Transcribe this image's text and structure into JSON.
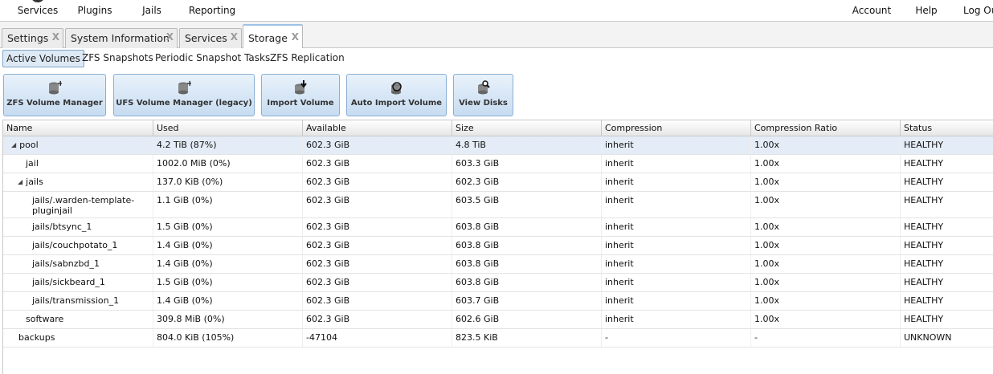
{
  "nav": {
    "items": [
      {
        "label": "Services",
        "icon": "gear-icon"
      },
      {
        "label": "Plugins",
        "icon": "plugin-icon"
      },
      {
        "label": "Jails",
        "icon": "jail-icon"
      },
      {
        "label": "Reporting",
        "icon": "chart-icon"
      },
      {
        "label": "Account",
        "icon": "user-icon"
      },
      {
        "label": "Help",
        "icon": "help-icon"
      },
      {
        "label": "Log Ou",
        "icon": "logout-icon"
      }
    ]
  },
  "tabs": [
    {
      "label": "Settings",
      "close": "X"
    },
    {
      "label": "System Information",
      "close": "X"
    },
    {
      "label": "Services",
      "close": "X"
    },
    {
      "label": "Storage",
      "close": "X"
    }
  ],
  "subtabs": [
    "Active Volumes",
    "ZFS Snapshots",
    "Periodic Snapshot Tasks",
    "ZFS Replication"
  ],
  "toolbar": [
    {
      "label": "ZFS Volume Manager",
      "icon": "database-add-icon"
    },
    {
      "label": "UFS Volume Manager (legacy)",
      "icon": "database-add-icon"
    },
    {
      "label": "Import Volume",
      "icon": "database-import-icon"
    },
    {
      "label": "Auto Import Volume",
      "icon": "database-refresh-icon"
    },
    {
      "label": "View Disks",
      "icon": "database-search-icon"
    }
  ],
  "grid": {
    "columns": [
      "Name",
      "Used",
      "Available",
      "Size",
      "Compression",
      "Compression Ratio",
      "Status"
    ],
    "rows": [
      {
        "name": "pool",
        "expander": "◢",
        "used": "4.2 TiB (87%)",
        "available": "602.3 GiB",
        "size": "4.8 TiB",
        "compression": "inherit",
        "ratio": "1.00x",
        "status": "HEALTHY"
      },
      {
        "name": "jail",
        "expander": "",
        "used": "1002.0 MiB (0%)",
        "available": "602.3 GiB",
        "size": "603.3 GiB",
        "compression": "inherit",
        "ratio": "1.00x",
        "status": "HEALTHY"
      },
      {
        "name": "jails",
        "expander": "◢",
        "used": "137.0 KiB (0%)",
        "available": "602.3 GiB",
        "size": "602.3 GiB",
        "compression": "inherit",
        "ratio": "1.00x",
        "status": "HEALTHY"
      },
      {
        "name": "jails/.warden-template-pluginjail",
        "expander": "",
        "used": "1.1 GiB (0%)",
        "available": "602.3 GiB",
        "size": "603.5 GiB",
        "compression": "inherit",
        "ratio": "1.00x",
        "status": "HEALTHY"
      },
      {
        "name": "jails/btsync_1",
        "expander": "",
        "used": "1.5 GiB (0%)",
        "available": "602.3 GiB",
        "size": "603.8 GiB",
        "compression": "inherit",
        "ratio": "1.00x",
        "status": "HEALTHY"
      },
      {
        "name": "jails/couchpotato_1",
        "expander": "",
        "used": "1.4 GiB (0%)",
        "available": "602.3 GiB",
        "size": "603.8 GiB",
        "compression": "inherit",
        "ratio": "1.00x",
        "status": "HEALTHY"
      },
      {
        "name": "jails/sabnzbd_1",
        "expander": "",
        "used": "1.4 GiB (0%)",
        "available": "602.3 GiB",
        "size": "603.8 GiB",
        "compression": "inherit",
        "ratio": "1.00x",
        "status": "HEALTHY"
      },
      {
        "name": "jails/sickbeard_1",
        "expander": "",
        "used": "1.5 GiB (0%)",
        "available": "602.3 GiB",
        "size": "603.8 GiB",
        "compression": "inherit",
        "ratio": "1.00x",
        "status": "HEALTHY"
      },
      {
        "name": "jails/transmission_1",
        "expander": "",
        "used": "1.4 GiB (0%)",
        "available": "602.3 GiB",
        "size": "603.7 GiB",
        "compression": "inherit",
        "ratio": "1.00x",
        "status": "HEALTHY"
      },
      {
        "name": "software",
        "expander": "",
        "used": "309.8 MiB (0%)",
        "available": "602.3 GiB",
        "size": "602.6 GiB",
        "compression": "inherit",
        "ratio": "1.00x",
        "status": "HEALTHY"
      },
      {
        "name": "backups",
        "expander": "",
        "used": "804.0 KiB (105%)",
        "available": "-47104",
        "size": "823.5 KiB",
        "compression": "-",
        "ratio": "-",
        "status": "UNKNOWN"
      }
    ]
  }
}
